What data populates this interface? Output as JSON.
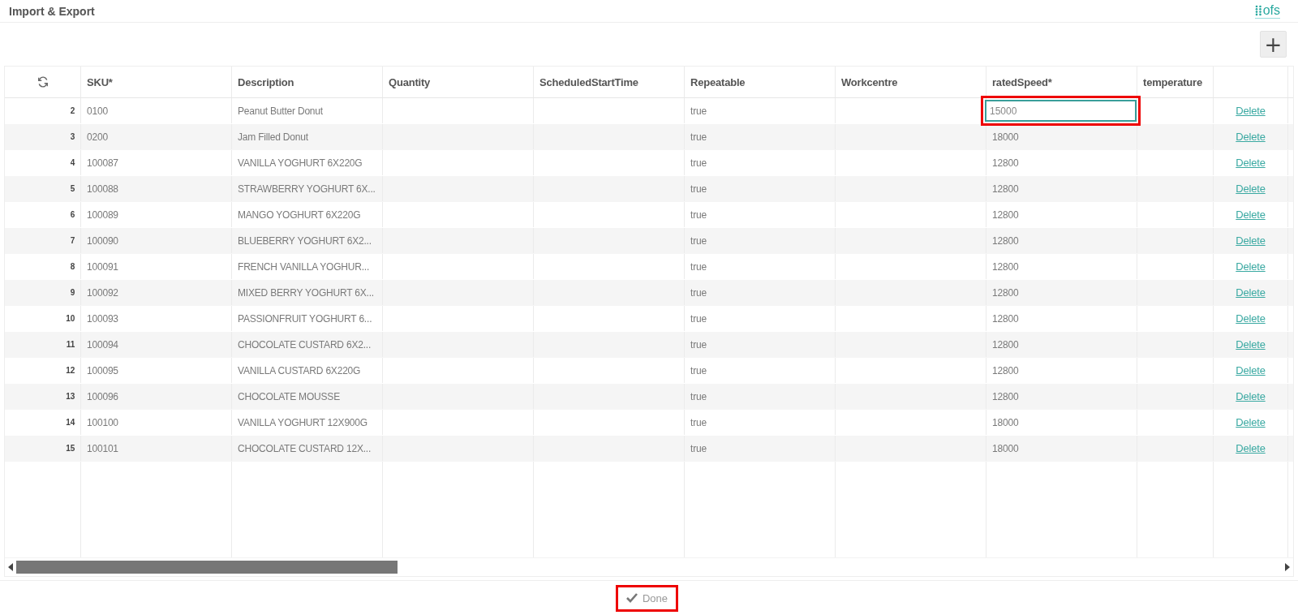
{
  "window": {
    "title": "Import & Export",
    "logo_text": "ofs"
  },
  "add_button": {
    "label": "+"
  },
  "table": {
    "columns": [
      "SKU*",
      "Description",
      "Quantity",
      "ScheduledStartTime",
      "Repeatable",
      "Workcentre",
      "ratedSpeed*",
      "temperature"
    ],
    "rows": [
      {
        "row_number": "2",
        "sku": "0100",
        "description": "Peanut Butter Donut",
        "repeatable": "true",
        "rated_speed": "15000",
        "editing": true,
        "action": "Delete"
      },
      {
        "row_number": "3",
        "sku": "0200",
        "description": "Jam Filled Donut",
        "repeatable": "true",
        "rated_speed": "18000",
        "editing": false,
        "action": "Delete"
      },
      {
        "row_number": "4",
        "sku": "100087",
        "description": "VANILLA YOGHURT 6X220G",
        "repeatable": "true",
        "rated_speed": "12800",
        "editing": false,
        "action": "Delete"
      },
      {
        "row_number": "5",
        "sku": "100088",
        "description": "STRAWBERRY YOGHURT 6X...",
        "repeatable": "true",
        "rated_speed": "12800",
        "editing": false,
        "action": "Delete"
      },
      {
        "row_number": "6",
        "sku": "100089",
        "description": "MANGO YOGHURT 6X220G",
        "repeatable": "true",
        "rated_speed": "12800",
        "editing": false,
        "action": "Delete"
      },
      {
        "row_number": "7",
        "sku": "100090",
        "description": "BLUEBERRY YOGHURT 6X2...",
        "repeatable": "true",
        "rated_speed": "12800",
        "editing": false,
        "action": "Delete"
      },
      {
        "row_number": "8",
        "sku": "100091",
        "description": "FRENCH VANILLA YOGHUR...",
        "repeatable": "true",
        "rated_speed": "12800",
        "editing": false,
        "action": "Delete"
      },
      {
        "row_number": "9",
        "sku": "100092",
        "description": "MIXED BERRY YOGHURT 6X...",
        "repeatable": "true",
        "rated_speed": "12800",
        "editing": false,
        "action": "Delete"
      },
      {
        "row_number": "10",
        "sku": "100093",
        "description": "PASSIONFRUIT YOGHURT 6...",
        "repeatable": "true",
        "rated_speed": "12800",
        "editing": false,
        "action": "Delete"
      },
      {
        "row_number": "11",
        "sku": "100094",
        "description": "CHOCOLATE CUSTARD 6X2...",
        "repeatable": "true",
        "rated_speed": "12800",
        "editing": false,
        "action": "Delete"
      },
      {
        "row_number": "12",
        "sku": "100095",
        "description": "VANILLA CUSTARD 6X220G",
        "repeatable": "true",
        "rated_speed": "12800",
        "editing": false,
        "action": "Delete"
      },
      {
        "row_number": "13",
        "sku": "100096",
        "description": "CHOCOLATE MOUSSE",
        "repeatable": "true",
        "rated_speed": "12800",
        "editing": false,
        "action": "Delete"
      },
      {
        "row_number": "14",
        "sku": "100100",
        "description": "VANILLA YOGHURT 12X900G",
        "repeatable": "true",
        "rated_speed": "18000",
        "editing": false,
        "action": "Delete"
      },
      {
        "row_number": "15",
        "sku": "100101",
        "description": "CHOCOLATE CUSTARD 12X...",
        "repeatable": "true",
        "rated_speed": "18000",
        "editing": false,
        "action": "Delete"
      }
    ]
  },
  "done_button": {
    "label": "Done",
    "highlighted": true
  }
}
